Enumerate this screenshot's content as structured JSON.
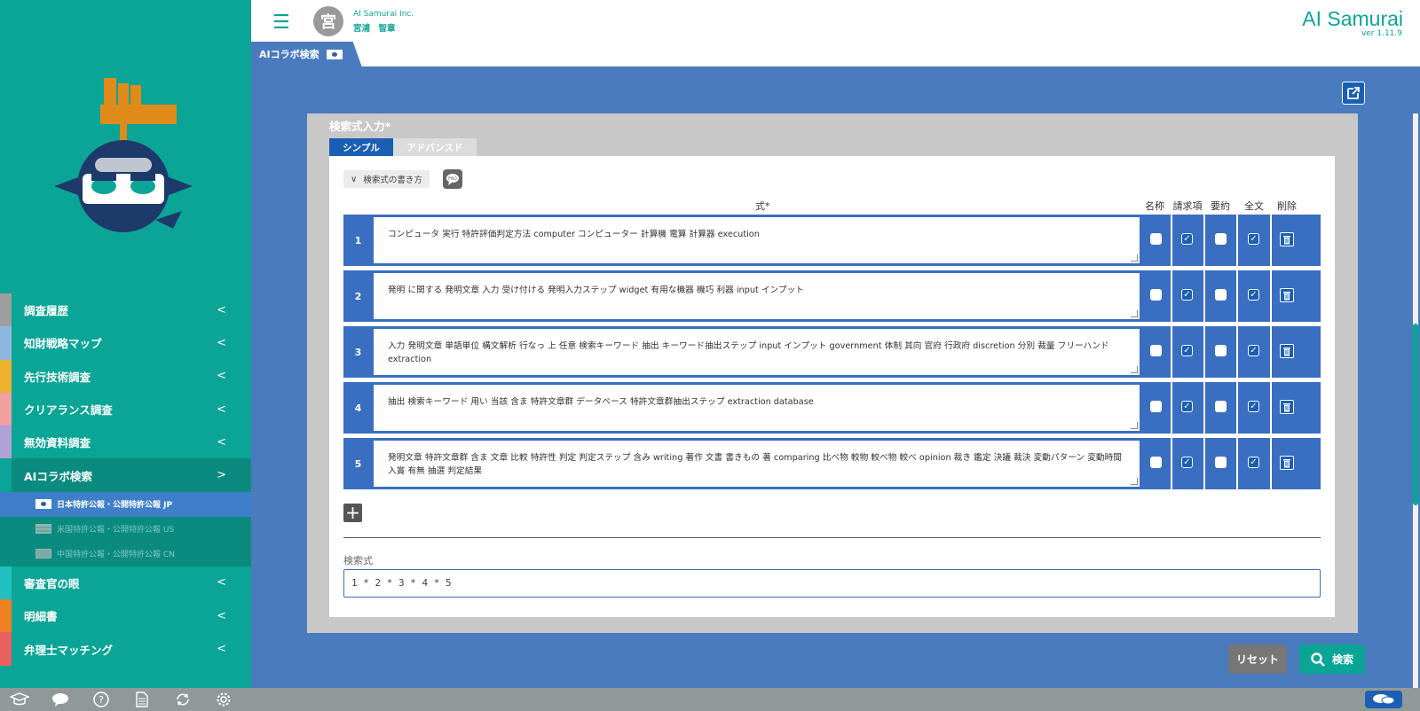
{
  "header": {
    "avatar_char": "宮",
    "company": "AI Samurai Inc.",
    "username": "宮浦　智章",
    "brand": "AI Samurai",
    "version": "ver 1.11.9"
  },
  "tab": {
    "label": "AIコラボ検索"
  },
  "sidebar": {
    "items": [
      {
        "label": "調査履歴",
        "stripe": "#9e9e9e"
      },
      {
        "label": "知財戦略マップ",
        "stripe": "#8fb8e0"
      },
      {
        "label": "先行技術調査",
        "stripe": "#f0b030"
      },
      {
        "label": "クリアランス調査",
        "stripe": "#f0a0a0"
      },
      {
        "label": "無効資料調査",
        "stripe": "#b0a0d8"
      },
      {
        "label": "AIコラボ検索",
        "stripe": "#0aa596"
      },
      {
        "label": "審査官の眼",
        "stripe": "#20c0c0"
      },
      {
        "label": "明細書",
        "stripe": "#f08020"
      },
      {
        "label": "弁理士マッチング",
        "stripe": "#e86060"
      }
    ],
    "sub_items": [
      {
        "label": "日本特許公報・公開特許公報 JP"
      },
      {
        "label": "米国特許公報・公開特許公報 US"
      },
      {
        "label": "中国特許公報・公開特許公報 CN"
      }
    ]
  },
  "panel": {
    "title": "検索式入力*",
    "mode_simple": "シンプル",
    "mode_advanced": "アドバンスド",
    "howto": "検索式の書き方",
    "formula_col": "式*",
    "columns": [
      "名称",
      "請求項",
      "要約",
      "全文",
      "削除"
    ],
    "rows": [
      {
        "num": "1",
        "text": "コンピュータ 実行 特許評価判定方法 computer コンピューター 計算機 電算 計算器 execution",
        "name": false,
        "claims": true,
        "abstract": false,
        "full": true
      },
      {
        "num": "2",
        "text": "発明 に関する 発明文章 入力 受け付ける 発明入力ステップ widget 有用な機器 機巧 利器 input インプット",
        "name": false,
        "claims": true,
        "abstract": false,
        "full": true
      },
      {
        "num": "3",
        "text": "入力 発明文章 単語単位 構文解析 行なっ 上 任意 検索キーワード 抽出 キーワード抽出ステップ input インプット government 体制 其向 官府 行政府 discretion 分別 裁量 フリーハンド extraction",
        "name": false,
        "claims": true,
        "abstract": false,
        "full": true
      },
      {
        "num": "4",
        "text": "抽出 検索キーワード 用い 当該 含ま 特許文章群 データベース 特許文章群抽出ステップ extraction database",
        "name": false,
        "claims": true,
        "abstract": false,
        "full": true
      },
      {
        "num": "5",
        "text": "発明文章 特許文章群 含ま 文章 比較 特許性 判定 判定ステップ 含み writing 著作 文書 書きもの 著 comparing 比べ物 較物 較べ物 較べ opinion 裁き 鑑定 決議 裁決 変動パターン 変動時間 入賞 有無 抽選 判定結果",
        "name": false,
        "claims": true,
        "abstract": false,
        "full": true
      }
    ],
    "formula_label": "検索式",
    "formula_value": "1 * 2 * 3 * 4 * 5"
  },
  "buttons": {
    "reset": "リセット",
    "search": "検索"
  },
  "colors": {
    "teal": "#0aa596",
    "blue": "#4a7bbf",
    "dark_blue": "#1a5fb4"
  }
}
